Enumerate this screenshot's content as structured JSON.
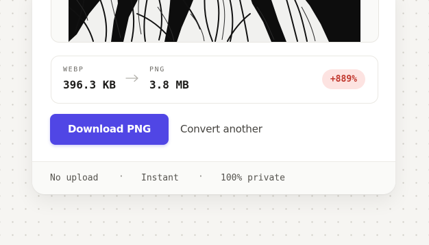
{
  "conversion": {
    "from_format": "WEBP",
    "from_size": "396.3 KB",
    "to_format": "PNG",
    "to_size": "3.8 MB",
    "size_change": "+889%"
  },
  "actions": {
    "download_label": "Download PNG",
    "convert_another_label": "Convert another"
  },
  "footer": {
    "items": [
      "No upload",
      "Instant",
      "100% private"
    ],
    "separator": "·"
  },
  "icons": {
    "arrow": "arrow-right-icon"
  },
  "colors": {
    "accent": "#5046e5",
    "badge_background": "#fde3e1",
    "badge_text": "#c0352b",
    "page_background": "#f6f5f2"
  }
}
